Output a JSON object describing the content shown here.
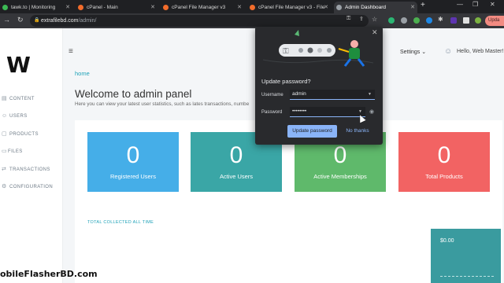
{
  "browser": {
    "tabs": [
      {
        "label": "tawk.to | Monitoring"
      },
      {
        "label": "cPanel - Main"
      },
      {
        "label": "cPanel File Manager v3"
      },
      {
        "label": "cPanel File Manager v3 - File"
      },
      {
        "label": "Admin Dashboard",
        "active": true
      }
    ],
    "new_tab": "+",
    "url_host": "extrafilebd.com",
    "url_path": "/admin/",
    "update_label": "Upda"
  },
  "sidebar": {
    "items": [
      {
        "label": "CONTENT",
        "icon": "content-icon"
      },
      {
        "label": "USERS",
        "icon": "users-icon"
      },
      {
        "label": "PRODUCTS",
        "icon": "products-icon"
      },
      {
        "label": "FILES",
        "icon": "files-icon"
      },
      {
        "label": "TRANSACTIONS",
        "icon": "transactions-icon"
      },
      {
        "label": "CONFIGURATION",
        "icon": "configuration-icon"
      }
    ]
  },
  "header": {
    "settings_label": "Settings",
    "greeting": "Hello, Web Master!"
  },
  "main": {
    "breadcrumb": "home",
    "title": "Welcome to admin panel",
    "subtitle": "Here you can view your latest user statistics, such as lates transactions, numbe",
    "cards": [
      {
        "value": "0",
        "label": "Registered Users",
        "color": "#45aee8"
      },
      {
        "value": "0",
        "label": "Active Users",
        "color": "#3aa6a6"
      },
      {
        "value": "0",
        "label": "Active Memberships",
        "color": "#5fb96b"
      },
      {
        "value": "0",
        "label": "Total Products",
        "color": "#f26363"
      }
    ],
    "total_label": "TOTAL COLLECTED ALL TIME",
    "total_value": "$0.00"
  },
  "password_popup": {
    "title": "Update password?",
    "username_label": "Username",
    "username_value": "admin",
    "password_label": "Password",
    "password_value": "••••••••",
    "update_button": "Update password",
    "dismiss_button": "No thanks",
    "accent": "#8ab4f8"
  },
  "watermark": "obileFlasherBD.com"
}
